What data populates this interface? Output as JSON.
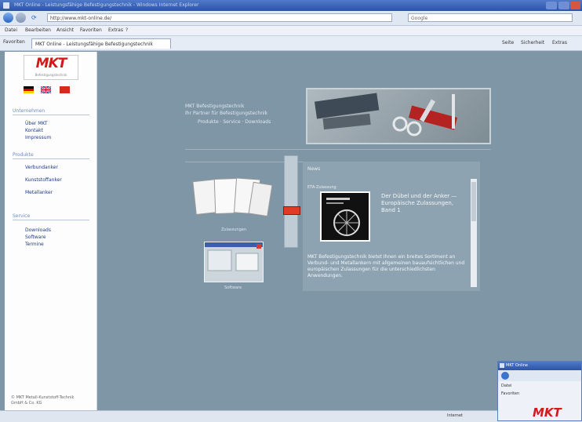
{
  "window": {
    "title": "MKT Online - Leistungsfähige Befestigungstechnik - Windows Internet Explorer"
  },
  "browser": {
    "address": "http://www.mkt-online.de/",
    "search_placeholder": "Google",
    "menu": [
      "Datei",
      "Bearbeiten",
      "Ansicht",
      "Favoriten",
      "Extras",
      "?"
    ],
    "favorites_label": "Favoriten",
    "tab_title": "MKT Online - Leistungsfähige Befestigungstechnik",
    "tools": [
      "Seite",
      "Sicherheit",
      "Extras"
    ],
    "status": "Internet"
  },
  "sidebar": {
    "logo": "MKT",
    "logo_tagline": "Befestigungstechnik",
    "sections": [
      {
        "heading": "Unternehmen",
        "links": [
          "Über MKT",
          "Kontakt",
          "Impressum"
        ]
      },
      {
        "heading": "Produkte",
        "links": [
          "Verbundanker",
          "Kunststoffanker",
          "Metallanker"
        ]
      },
      {
        "heading": "Service",
        "links": [
          "Downloads",
          "Software",
          "Termine"
        ]
      }
    ],
    "footer_lines": [
      "© MKT Metall-Kunststoff-Technik",
      "GmbH & Co. KG"
    ]
  },
  "main": {
    "info_lines": [
      "MKT Befestigungstechnik",
      "Ihr Partner für Befestigungstechnik",
      "Produkte · Service · Downloads"
    ],
    "docs_caption": "Zulassungen",
    "software_caption": "Software",
    "news": {
      "title": "News",
      "subtitle": "ETA-Zulassung",
      "headline": "Der Dübel und der Anker — Europäische Zulassungen, Band 1",
      "body": "MKT Befestigungstechnik bietet Ihnen ein breites Sortiment an Verbund- und Metallankern mit allgemeinen bauaufsichtlichen und europäischen Zulassungen für die unterschiedlichsten Anwendungen."
    }
  },
  "overlay": {
    "title": "MKT Online",
    "logo": "MKT"
  }
}
